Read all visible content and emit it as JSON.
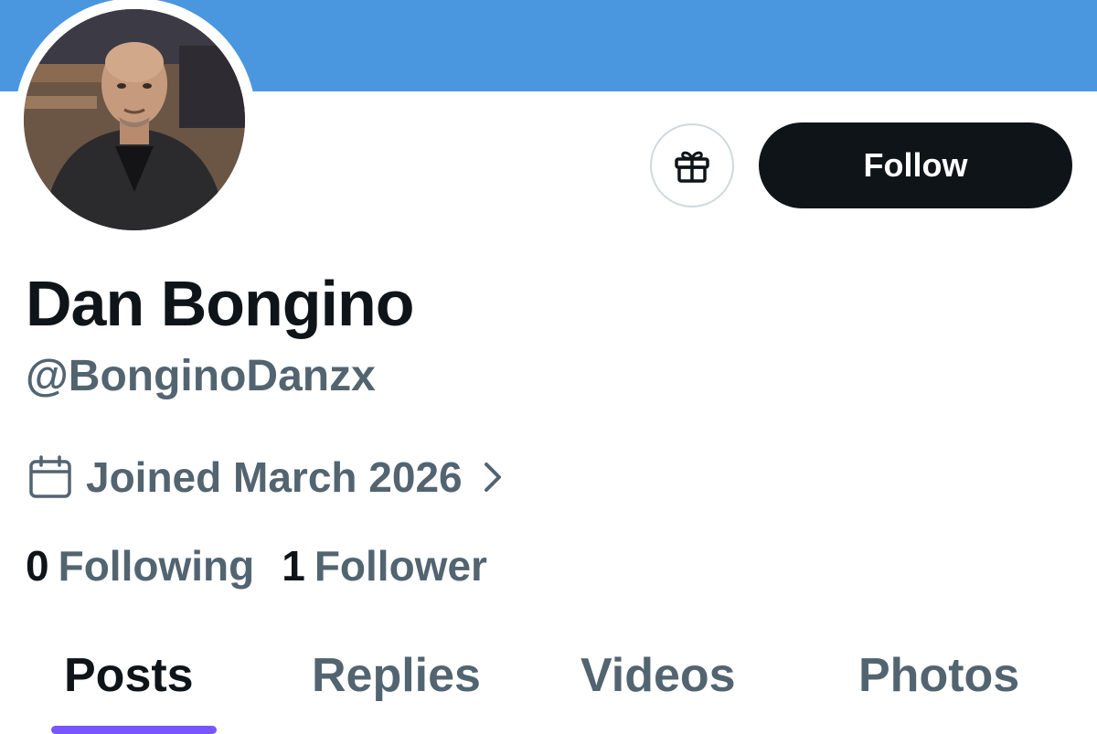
{
  "profile": {
    "display_name": "Dan Bongino",
    "handle": "@BonginoDanzx",
    "joined": "Joined March 2026",
    "avatar_alt": "profile photo"
  },
  "actions": {
    "gift_icon": "gift-icon",
    "follow_label": "Follow"
  },
  "stats": {
    "following_count": "0",
    "following_label": "Following",
    "followers_count": "1",
    "followers_label": "Follower"
  },
  "tabs": [
    {
      "label": "Posts",
      "active": true
    },
    {
      "label": "Replies",
      "active": false
    },
    {
      "label": "Videos",
      "active": false
    },
    {
      "label": "Photos",
      "active": false
    }
  ],
  "colors": {
    "banner": "#4a97df",
    "primary_text": "#0f1419",
    "secondary_text": "#536471",
    "tab_indicator": "#7856ff",
    "follow_button": "#0f1419"
  }
}
